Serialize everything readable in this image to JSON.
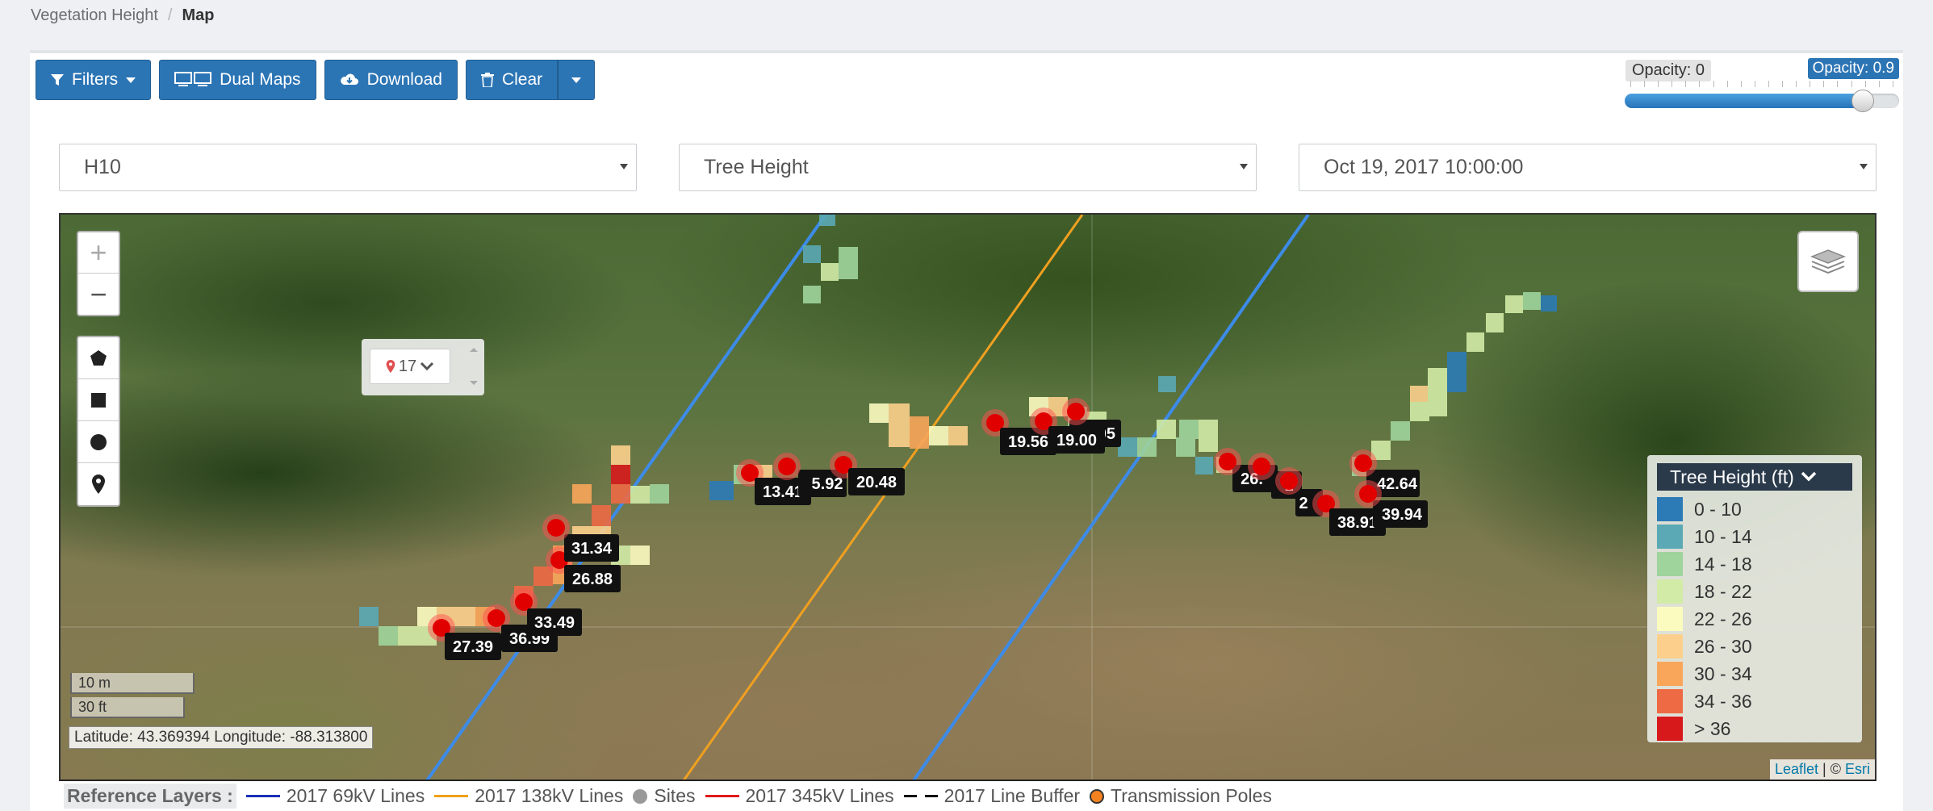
{
  "breadcrumb": {
    "parent": "Vegetation Height",
    "separator": "/",
    "current": "Map"
  },
  "toolbar": {
    "filters_label": "Filters",
    "dual_maps_label": "Dual Maps",
    "download_label": "Download",
    "clear_label": "Clear"
  },
  "opacity": {
    "min_label": "Opacity: 0",
    "max_label": "Opacity: 0.9",
    "value": 0.9
  },
  "selects": {
    "site": "H10",
    "layer": "Tree Height",
    "date": "Oct 19, 2017 10:00:00"
  },
  "cluster_control": {
    "count": "17"
  },
  "legend": {
    "title": "Tree Height (ft)",
    "items": [
      {
        "label": "0 - 10",
        "color": "#2c7bb6"
      },
      {
        "label": "10 - 14",
        "color": "#5aa9b5"
      },
      {
        "label": "14 - 18",
        "color": "#9fd49c"
      },
      {
        "label": "18 - 22",
        "color": "#d2eba6"
      },
      {
        "label": "22 - 26",
        "color": "#fbfbc0"
      },
      {
        "label": "26 - 30",
        "color": "#fcd08c"
      },
      {
        "label": "30 - 34",
        "color": "#f9a65a"
      },
      {
        "label": "34 - 36",
        "color": "#ed6a45"
      },
      {
        "label": "> 36",
        "color": "#d7191c"
      }
    ]
  },
  "tree_markers": [
    {
      "label": "27.39"
    },
    {
      "label": "36.99"
    },
    {
      "label": "33.49"
    },
    {
      "label": "26.88"
    },
    {
      "label": "31.34"
    },
    {
      "label": "13.41"
    },
    {
      "label": "5.92"
    },
    {
      "label": "20.48"
    },
    {
      "label": "19.56"
    },
    {
      "label": "19.00"
    },
    {
      "label": "20.05"
    },
    {
      "label": "26."
    },
    {
      "label": "2"
    },
    {
      "label": "1"
    },
    {
      "label": "38.91"
    },
    {
      "label": "42.64"
    },
    {
      "label": "39.94"
    }
  ],
  "scale": {
    "metric": "10 m",
    "imperial": "30 ft"
  },
  "coordinates": "Latitude: 43.369394 Longitude: -88.313800",
  "attribution": {
    "leaflet": "Leaflet",
    "separator": "| ©",
    "esri": "Esri"
  },
  "reference_layers": {
    "title": "Reference Layers :",
    "items": [
      {
        "label": "2017 69kV Lines",
        "color": "#1a2fb8",
        "kind": "line"
      },
      {
        "label": "2017 138kV Lines",
        "color": "#f0a018",
        "kind": "line"
      },
      {
        "label": "Sites",
        "color": "#999999",
        "kind": "dot"
      },
      {
        "label": "2017 345kV Lines",
        "color": "#e01a1a",
        "kind": "line"
      },
      {
        "label": "2017 Line Buffer",
        "color": "#111111",
        "kind": "dash"
      },
      {
        "label": "Transmission Poles",
        "color": "#f58220",
        "kind": "pole"
      }
    ]
  }
}
